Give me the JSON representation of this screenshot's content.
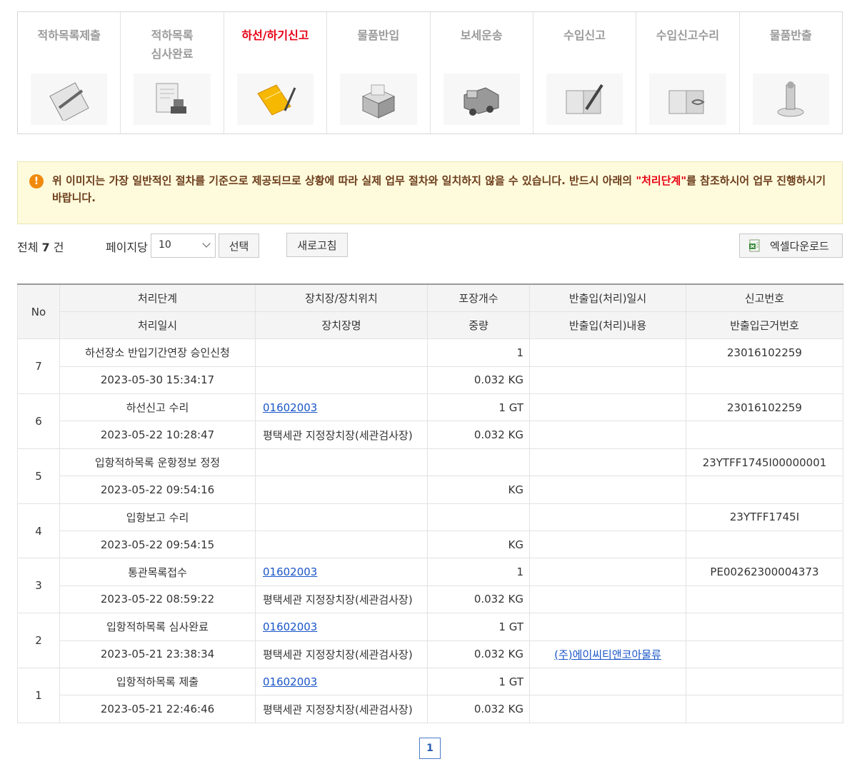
{
  "steps": [
    {
      "label": "적하목록제출",
      "icon": "clipboard-pen-icon",
      "active": false
    },
    {
      "label": "적하목록\n심사완료",
      "icon": "document-stamp-icon",
      "active": false
    },
    {
      "label": "하선/하기신고",
      "icon": "folder-pen-icon",
      "active": true
    },
    {
      "label": "물품반입",
      "icon": "open-box-icon",
      "active": false
    },
    {
      "label": "보세운송",
      "icon": "truck-icon",
      "active": false
    },
    {
      "label": "수입신고",
      "icon": "book-pen-icon",
      "active": false
    },
    {
      "label": "수입신고수리",
      "icon": "book-stamp-icon",
      "active": false
    },
    {
      "label": "물품반출",
      "icon": "stamp-icon",
      "active": false
    }
  ],
  "notice": {
    "text_before": "위 이미지는 가장 일반적인 절차를 기준으로 제공되므로 상황에 따라 실제 업무 절차와 일치하지 않을 수 있습니다. 반드시 아래의 ",
    "highlight": "\"처리단계\"",
    "text_after": "를 참조하시어 업무 진행하시기 바랍니다."
  },
  "controls": {
    "total_prefix": "전체",
    "total_count": "7",
    "total_suffix": "건",
    "per_page_label": "페이지당",
    "per_page_value": "10",
    "select_button": "선택",
    "refresh_button": "새로고침",
    "excel_button": "엑셀다운로드"
  },
  "table": {
    "headers": {
      "no": "No",
      "stage": "처리단계",
      "stage_date": "처리일시",
      "location": "장치장/장치위치",
      "location_name": "장치장명",
      "pkg": "포장개수",
      "weight": "중량",
      "inout_date": "반출입(처리)일시",
      "inout_content": "반출입(처리)내용",
      "report_no": "신고번호",
      "basis_no": "반출입근거번호"
    },
    "rows": [
      {
        "no": "7",
        "stage": "하선장소 반입기간연장 승인신청",
        "date": "2023-05-30 15:34:17",
        "loc_code": "",
        "loc_name": "",
        "pkg": "1",
        "weight": "0.032 KG",
        "inout_date": "",
        "inout_content": "",
        "report_no": "23016102259",
        "basis_no": ""
      },
      {
        "no": "6",
        "stage": "하선신고 수리",
        "date": "2023-05-22 10:28:47",
        "loc_code": "01602003",
        "loc_name": "평택세관 지정장치장(세관검사장)",
        "pkg": "1 GT",
        "weight": "0.032 KG",
        "inout_date": "",
        "inout_content": "",
        "report_no": "23016102259",
        "basis_no": ""
      },
      {
        "no": "5",
        "stage": "입항적하목록 운항정보 정정",
        "date": "2023-05-22 09:54:16",
        "loc_code": "",
        "loc_name": "",
        "pkg": "",
        "weight": "KG",
        "inout_date": "",
        "inout_content": "",
        "report_no": "23YTFF1745I00000001",
        "basis_no": ""
      },
      {
        "no": "4",
        "stage": "입항보고 수리",
        "date": "2023-05-22 09:54:15",
        "loc_code": "",
        "loc_name": "",
        "pkg": "",
        "weight": "KG",
        "inout_date": "",
        "inout_content": "",
        "report_no": "23YTFF1745I",
        "basis_no": ""
      },
      {
        "no": "3",
        "stage": "통관목록접수",
        "date": "2023-05-22 08:59:22",
        "loc_code": "01602003",
        "loc_name": "평택세관 지정장치장(세관검사장)",
        "pkg": "1",
        "weight": "0.032 KG",
        "inout_date": "",
        "inout_content": "",
        "report_no": "PE00262300004373",
        "basis_no": ""
      },
      {
        "no": "2",
        "stage": "입항적하목록 심사완료",
        "date": "2023-05-21 23:38:34",
        "loc_code": "01602003",
        "loc_name": "평택세관 지정장치장(세관검사장)",
        "pkg": "1 GT",
        "weight": "0.032 KG",
        "inout_date": "",
        "inout_content": "(주)에이씨티앤코아물류",
        "report_no": "",
        "basis_no": ""
      },
      {
        "no": "1",
        "stage": "입항적하목록 제출",
        "date": "2023-05-21 22:46:46",
        "loc_code": "01602003",
        "loc_name": "평택세관 지정장치장(세관검사장)",
        "pkg": "1 GT",
        "weight": "0.032 KG",
        "inout_date": "",
        "inout_content": "",
        "report_no": "",
        "basis_no": ""
      }
    ]
  },
  "pagination": {
    "current": "1"
  }
}
